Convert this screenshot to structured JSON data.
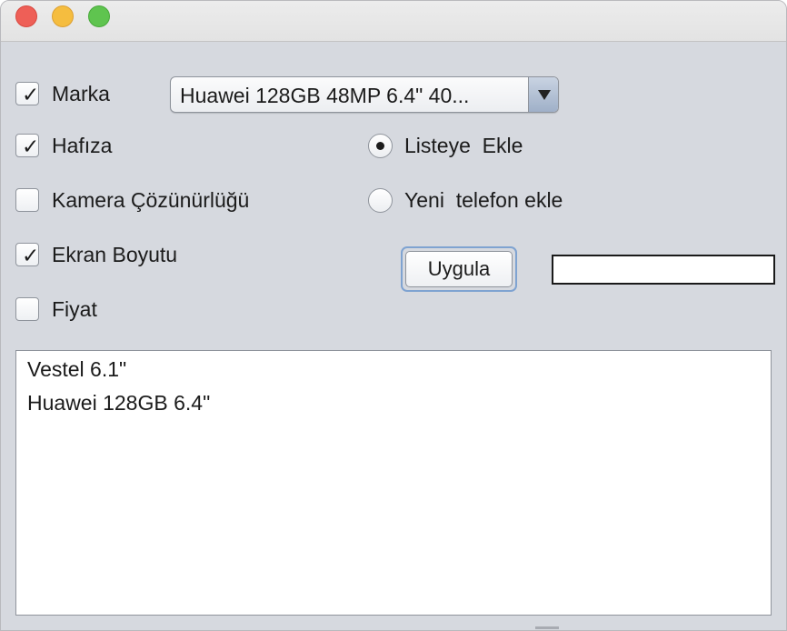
{
  "window": {
    "traffic_lights": {
      "close": "#ee5f57",
      "minimize": "#f5bd3f",
      "maximize": "#5fc44f"
    }
  },
  "filters": [
    {
      "label": "Marka",
      "checked": true
    },
    {
      "label": "Hafıza",
      "checked": true
    },
    {
      "label": "Kamera Çözünürlüğü",
      "checked": false
    },
    {
      "label": "Ekran Boyutu",
      "checked": true
    },
    {
      "label": "Fiyat",
      "checked": false
    }
  ],
  "check_mark": "✓",
  "phone_select": {
    "selected": "Huawei 128GB 48MP 6.4\" 40...",
    "arrow_icon": "chevron-down-icon"
  },
  "mode_radios": [
    {
      "label": "Listeye  Ekle",
      "selected": true
    },
    {
      "label": "Yeni  telefon ekle",
      "selected": false
    }
  ],
  "apply_button": {
    "label": "Uygula"
  },
  "input_field": {
    "value": ""
  },
  "results": {
    "items": [
      "Vestel 6.1\"",
      "Huawei 128GB 6.4\""
    ]
  }
}
